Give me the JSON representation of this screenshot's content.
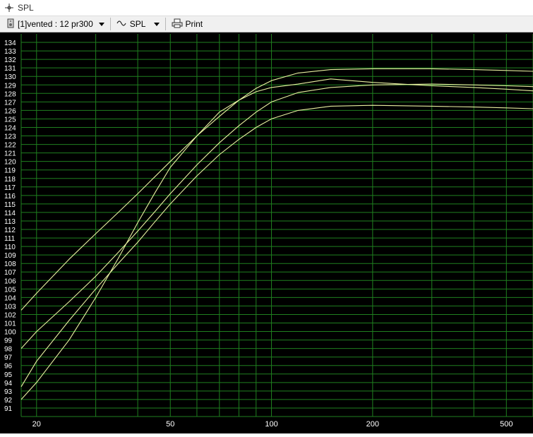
{
  "window": {
    "title": "SPL",
    "title_icon": "crosshair-icon"
  },
  "toolbar": {
    "project_select": {
      "value": "[1]vented : 12 pr300",
      "icon": "speaker-icon"
    },
    "view_select": {
      "value": "SPL",
      "icon": "waveform-icon"
    },
    "print_label": "Print",
    "print_icon": "printer-icon"
  },
  "colors": {
    "background": "#000000",
    "grid": "#1f7f1f",
    "axis_text": "#ffffff",
    "curve": "#e8f0a0"
  },
  "chart_data": {
    "type": "line",
    "xscale": "log",
    "xlim": [
      18,
      600
    ],
    "ylim": [
      90,
      135
    ],
    "x_tick_labels": [
      "20",
      "50",
      "100",
      "200",
      "500"
    ],
    "x_gridlines": [
      20,
      30,
      40,
      50,
      60,
      70,
      80,
      90,
      100,
      200,
      300,
      400,
      500,
      600
    ],
    "y_tick_labels": [
      "91",
      "92",
      "93",
      "94",
      "95",
      "96",
      "97",
      "98",
      "99",
      "100",
      "101",
      "102",
      "103",
      "104",
      "105",
      "106",
      "107",
      "108",
      "109",
      "110",
      "111",
      "112",
      "113",
      "114",
      "115",
      "116",
      "117",
      "118",
      "119",
      "120",
      "121",
      "122",
      "123",
      "124",
      "125",
      "126",
      "127",
      "128",
      "129",
      "130",
      "131",
      "132",
      "133",
      "134"
    ],
    "grid": true,
    "series": [
      {
        "x": [
          18,
          20,
          25,
          30,
          35,
          40,
          45,
          50,
          60,
          70,
          80,
          90,
          100,
          120,
          150,
          200,
          300,
          400,
          500,
          600
        ],
        "y": [
          102.5,
          104.5,
          108.5,
          111.5,
          114,
          116.2,
          118.2,
          120,
          123,
          125.3,
          127.2,
          128.6,
          129.5,
          130.4,
          130.8,
          130.9,
          130.9,
          130.8,
          130.7,
          130.6
        ]
      },
      {
        "x": [
          18,
          20,
          25,
          30,
          35,
          40,
          45,
          50,
          60,
          70,
          80,
          90,
          100,
          120,
          150,
          200,
          300,
          400,
          500,
          600
        ],
        "y": [
          98,
          100,
          103.5,
          106.5,
          109.3,
          111.8,
          114.1,
          116.2,
          119.6,
          122.2,
          124.2,
          125.8,
          127,
          128.1,
          128.7,
          129,
          129.1,
          129,
          128.9,
          128.8
        ]
      },
      {
        "x": [
          18,
          20,
          25,
          30,
          35,
          40,
          45,
          50,
          60,
          70,
          80,
          90,
          100,
          120,
          150,
          200,
          300,
          400,
          500,
          600
        ],
        "y": [
          92,
          94,
          99,
          104,
          108.6,
          112.8,
          116.3,
          119.3,
          123,
          125.8,
          127.2,
          128.2,
          128.7,
          129.1,
          129.7,
          129.3,
          128.9,
          128.7,
          128.5,
          128.3
        ]
      },
      {
        "x": [
          18,
          20,
          25,
          30,
          35,
          40,
          45,
          50,
          60,
          70,
          80,
          90,
          100,
          120,
          150,
          200,
          300,
          400,
          500,
          600
        ],
        "y": [
          93.5,
          96.5,
          101.3,
          105,
          108,
          110.5,
          112.9,
          115,
          118.3,
          120.8,
          122.6,
          124,
          125,
          126,
          126.5,
          126.6,
          126.5,
          126.4,
          126.3,
          126.2
        ]
      }
    ]
  }
}
